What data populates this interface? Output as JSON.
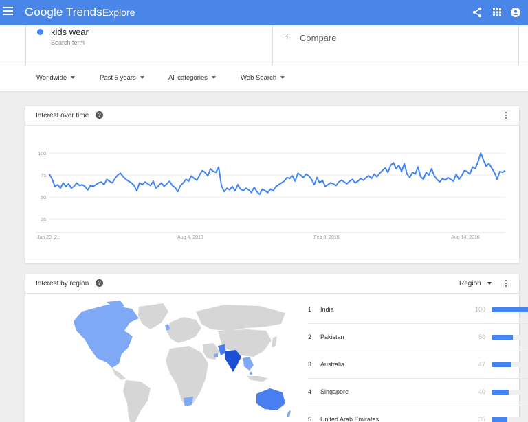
{
  "app": {
    "logo": "Google Trends",
    "nav": "Explore"
  },
  "search": {
    "term": "kids wear",
    "term_type": "Search term",
    "compare_label": "Compare"
  },
  "filters": [
    "Worldwide",
    "Past 5 years",
    "All categories",
    "Web Search"
  ],
  "interest_over_time": {
    "title": "Interest over time"
  },
  "chart_data": {
    "type": "line",
    "title": "",
    "x_tick_labels": [
      "Jan 29, 2...",
      "Aug 4, 2013",
      "Feb 8, 2015",
      "Aug 14, 2016"
    ],
    "y_tick_labels": [
      "100",
      "75",
      "50",
      "25"
    ],
    "ylim": [
      0,
      100
    ],
    "grid": true,
    "series": [
      {
        "values": [
          76,
          70,
          62,
          64,
          60,
          66,
          62,
          65,
          60,
          62,
          66,
          63,
          64,
          62,
          58,
          63,
          62,
          64,
          66,
          67,
          64,
          70,
          68,
          66,
          71,
          75,
          77,
          73,
          70,
          68,
          66,
          63,
          57,
          66,
          64,
          67,
          65,
          63,
          68,
          60,
          63,
          66,
          62,
          65,
          68,
          63,
          61,
          56,
          63,
          66,
          70,
          68,
          74,
          71,
          69,
          75,
          80,
          78,
          74,
          82,
          79,
          78,
          84,
          63,
          56,
          60,
          58,
          62,
          57,
          64,
          59,
          57,
          60,
          58,
          55,
          61,
          56,
          53,
          59,
          57,
          55,
          59,
          57,
          62,
          64,
          66,
          68,
          72,
          71,
          74,
          68,
          77,
          75,
          72,
          76,
          74,
          70,
          64,
          72,
          66,
          69,
          62,
          64,
          66,
          65,
          63,
          67,
          69,
          67,
          65,
          68,
          70,
          66,
          68,
          71,
          69,
          72,
          74,
          71,
          76,
          73,
          77,
          80,
          83,
          78,
          86,
          89,
          82,
          86,
          79,
          88,
          76,
          72,
          78,
          76,
          84,
          73,
          70,
          78,
          75,
          82,
          74,
          70,
          67,
          71,
          69,
          72,
          70,
          68,
          76,
          70,
          74,
          80,
          79,
          76,
          84,
          82,
          90,
          100,
          92,
          85,
          88,
          83,
          78,
          70,
          79,
          78,
          80
        ]
      }
    ]
  },
  "interest_by_region": {
    "title": "Interest by region",
    "sort_label": "Region",
    "rows": [
      {
        "rank": "1",
        "name": "India",
        "value": "100",
        "pct": 100
      },
      {
        "rank": "2",
        "name": "Pakistan",
        "value": "50",
        "pct": 50
      },
      {
        "rank": "3",
        "name": "Australia",
        "value": "47",
        "pct": 47
      },
      {
        "rank": "4",
        "name": "Singapore",
        "value": "40",
        "pct": 40
      },
      {
        "rank": "5",
        "name": "United Arab Emirates",
        "value": "35",
        "pct": 35
      }
    ]
  },
  "colors": {
    "accent": "#4a86e8",
    "line": "#4285f4",
    "map_dark": "#1a4fd6",
    "map_light": "#7fa9f5",
    "map_none": "#d6d6d6"
  },
  "icons": {
    "menu": "menu-icon",
    "share": "share-icon",
    "apps": "apps-icon",
    "account": "account-icon"
  }
}
